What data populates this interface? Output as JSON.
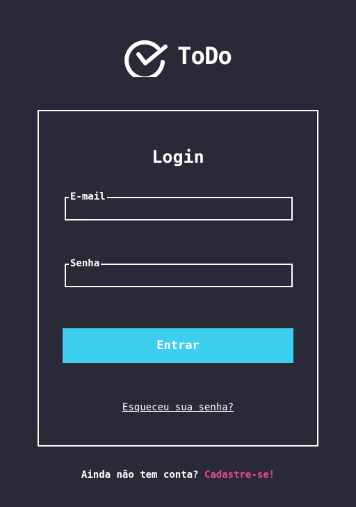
{
  "brand": {
    "name": "ToDo",
    "logo_icon": "check-circle-icon"
  },
  "login": {
    "title": "Login",
    "email_label": "E-mail",
    "email_value": "",
    "password_label": "Senha",
    "password_value": "",
    "submit_label": "Entrar",
    "forgot_label": "Esqueceu sua senha?"
  },
  "footer": {
    "prompt": "Ainda não tem conta?",
    "signup_label": "Cadastre-se!"
  },
  "colors": {
    "background": "#2a2937",
    "accent": "#3dcfef",
    "link_pink": "#e84a9d",
    "text": "#ffffff"
  }
}
